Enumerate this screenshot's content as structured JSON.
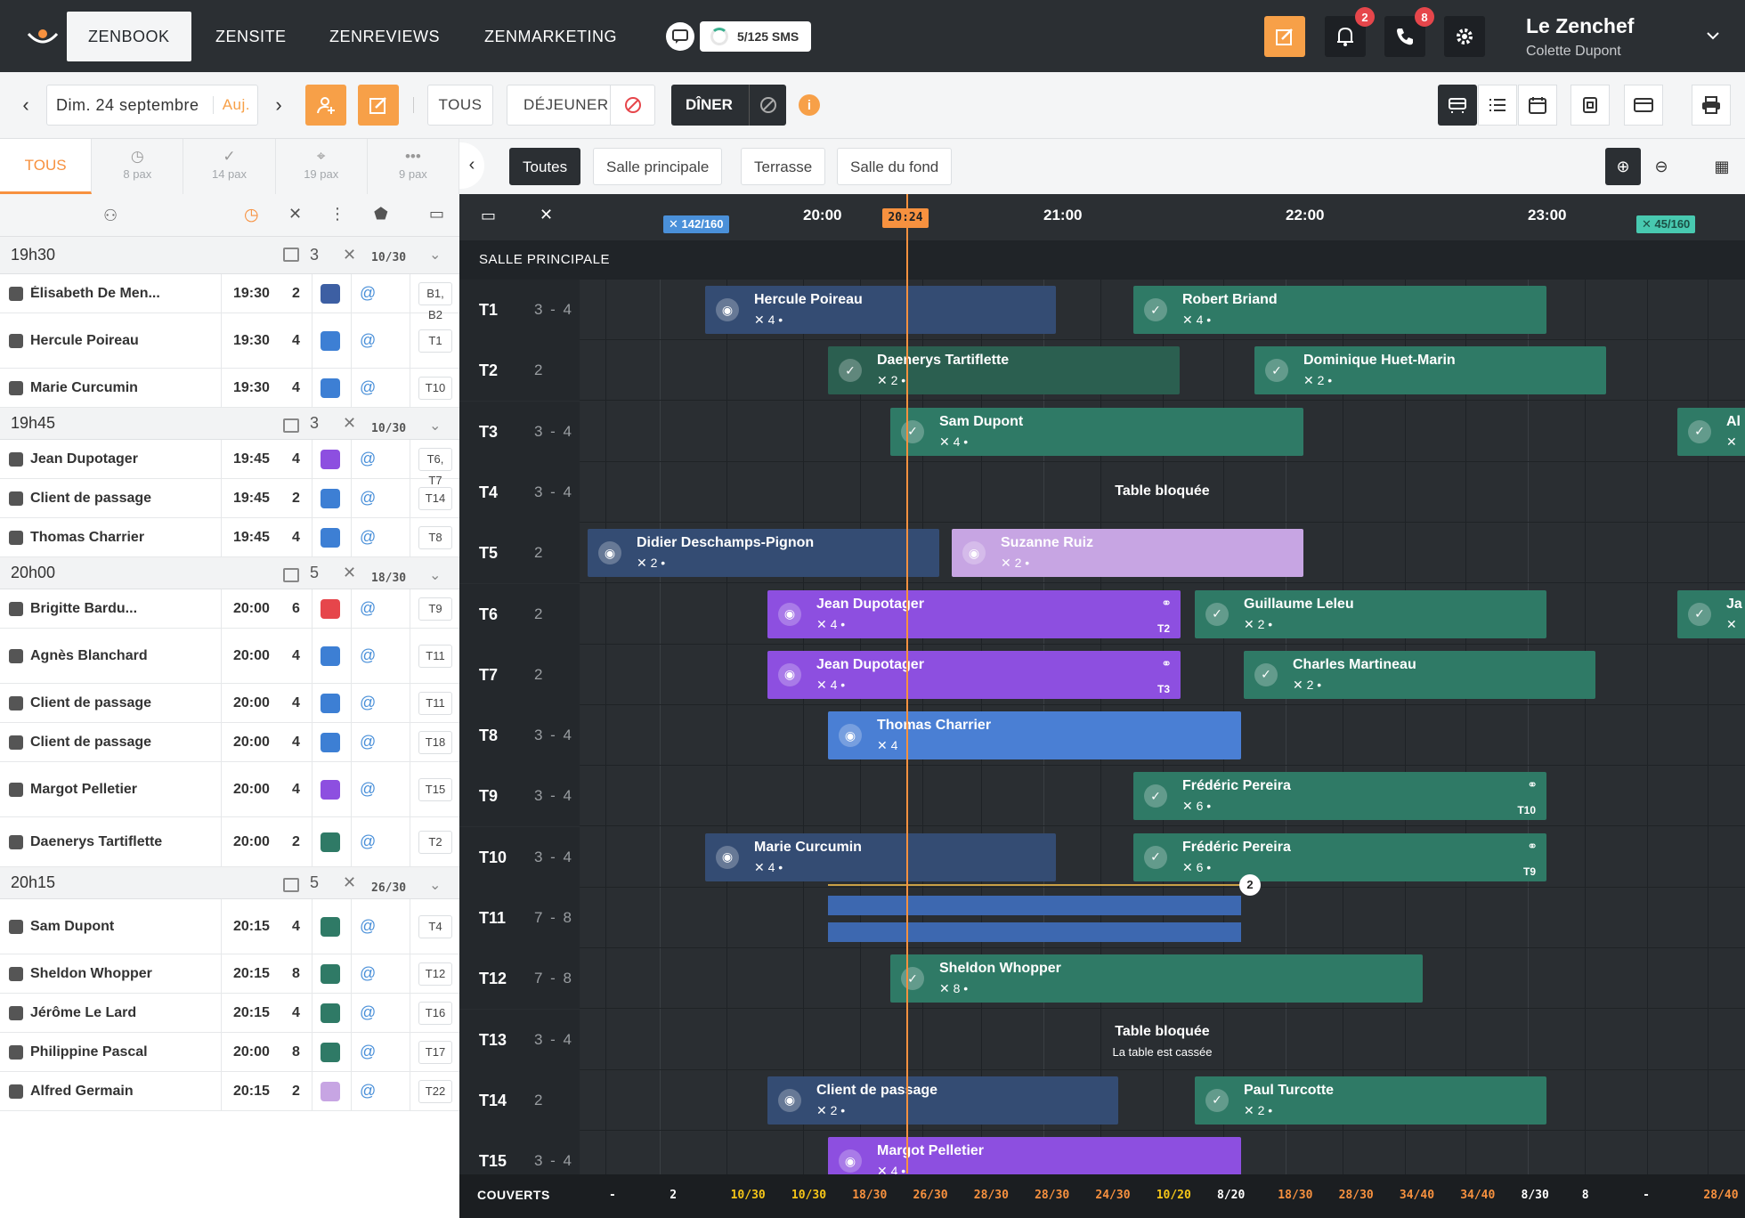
{
  "nav": {
    "tabs": [
      "ZENBOOK",
      "ZENSITE",
      "ZENREVIEWS",
      "ZENMARKETING"
    ],
    "sms": "5/125 SMS",
    "notif_count": "2",
    "calls_count": "8",
    "user_name": "Le Zenchef",
    "user_sub": "Colette Dupont"
  },
  "toolbar": {
    "date": "Dim. 24 septembre",
    "today": "Auj.",
    "all": "TOUS",
    "lunch": "DÉJEUNER",
    "dinner": "DÎNER"
  },
  "side_tabs": [
    {
      "label": "TOUS"
    },
    {
      "label": "8 pax"
    },
    {
      "label": "14 pax"
    },
    {
      "label": "19 pax"
    },
    {
      "label": "9 pax"
    }
  ],
  "rooms": {
    "all": "Toutes",
    "main": "Salle principale",
    "terrace": "Terrasse",
    "back": "Salle du fond"
  },
  "timeline": {
    "hours": [
      "20:00",
      "21:00",
      "22:00",
      "23:00"
    ],
    "now": "20:24",
    "cap_left": "142/160",
    "cap_right": "45/160",
    "section": "SALLE PRINCIPALE",
    "blocked": "Table bloquée",
    "broken": "La table est cassée",
    "couverts_label": "COUVERTS",
    "couverts": [
      "-",
      "2",
      "10/30",
      "10/30",
      "18/30",
      "26/30",
      "28/30",
      "28/30",
      "24/30",
      "10/20",
      "8/20",
      "18/30",
      "28/30",
      "34/40",
      "34/40",
      "8/30",
      "8",
      "-",
      "28/40"
    ]
  },
  "tables": [
    {
      "n": "T1",
      "c": "3 - 4"
    },
    {
      "n": "T2",
      "c": "2"
    },
    {
      "n": "T3",
      "c": "3 - 4"
    },
    {
      "n": "T4",
      "c": "3 - 4"
    },
    {
      "n": "T5",
      "c": "2"
    },
    {
      "n": "T6",
      "c": "2"
    },
    {
      "n": "T7",
      "c": "2"
    },
    {
      "n": "T8",
      "c": "3 - 4"
    },
    {
      "n": "T9",
      "c": "3 - 4"
    },
    {
      "n": "T10",
      "c": "3 - 4"
    },
    {
      "n": "T11",
      "c": "7 - 8"
    },
    {
      "n": "T12",
      "c": "7 - 8"
    },
    {
      "n": "T13",
      "c": "3 - 4"
    },
    {
      "n": "T14",
      "c": "2"
    },
    {
      "n": "T15",
      "c": "3 - 4"
    }
  ],
  "blocks": [
    {
      "name": "Hercule Poireau",
      "sub": "✕ 4 •",
      "cls": "blued"
    },
    {
      "name": "Robert Briand",
      "sub": "✕ 4 •",
      "cls": "green"
    },
    {
      "name": "Daenerys Tartiflette",
      "sub": "✕ 2 •",
      "cls": "greend"
    },
    {
      "name": "Dominique Huet-Marin",
      "sub": "✕ 2 •",
      "cls": "green"
    },
    {
      "name": "Sam Dupont",
      "sub": "✕ 4 •",
      "cls": "green"
    },
    {
      "name": "Didier Deschamps-Pignon",
      "sub": "✕ 2 •",
      "cls": "blued"
    },
    {
      "name": "Suzanne Ruiz",
      "sub": "✕ 2 •",
      "cls": "lilac"
    },
    {
      "name": "Jean Dupotager",
      "sub": "✕ 4 •",
      "cls": "purple",
      "tbl": "T2"
    },
    {
      "name": "Guillaume Leleu",
      "sub": "✕ 2 •",
      "cls": "green"
    },
    {
      "name": "Jean Dupotager",
      "sub": "✕ 4 •",
      "cls": "purple",
      "tbl": "T3"
    },
    {
      "name": "Charles Martineau",
      "sub": "✕ 2 •",
      "cls": "green"
    },
    {
      "name": "Thomas Charrier",
      "sub": "✕ 4",
      "cls": "blue"
    },
    {
      "name": "Frédéric Pereira",
      "sub": "✕ 6 •",
      "cls": "green",
      "tbl": "T10"
    },
    {
      "name": "Marie Curcumin",
      "sub": "✕ 4 •",
      "cls": "blued"
    },
    {
      "name": "Frédéric Pereira",
      "sub": "✕ 6 •",
      "cls": "green",
      "tbl": "T9"
    },
    {
      "name": "Sheldon Whopper",
      "sub": "✕ 8 •",
      "cls": "green"
    },
    {
      "name": "Client de passage",
      "sub": "✕ 2 •",
      "cls": "blued"
    },
    {
      "name": "Paul Turcotte",
      "sub": "✕ 2 •",
      "cls": "green"
    },
    {
      "name": "Margot Pelletier",
      "sub": "✕ 4 •",
      "cls": "purple"
    },
    {
      "name": "Al",
      "sub": "✕",
      "cls": "green"
    },
    {
      "name": "Ja",
      "sub": "✕",
      "cls": "green"
    }
  ],
  "list": [
    {
      "group": "19h30",
      "count": "3",
      "couverts": "10/30"
    },
    {
      "name": "Élisabeth De Men...",
      "time": "19:30",
      "pax": "2",
      "table": "B1, B2",
      "st": "#3d5fa3"
    },
    {
      "name": "Hercule Poireau",
      "time": "19:30",
      "pax": "4",
      "table": "T1",
      "st": "#3d7fd4"
    },
    {
      "name": "Marie Curcumin",
      "time": "19:30",
      "pax": "4",
      "table": "T10",
      "st": "#3d7fd4"
    },
    {
      "group": "19h45",
      "count": "3",
      "couverts": "10/30"
    },
    {
      "name": "Jean Dupotager",
      "time": "19:45",
      "pax": "4",
      "table": "T6, T7",
      "st": "#8d4fe0"
    },
    {
      "name": "Client de passage",
      "time": "19:45",
      "pax": "2",
      "table": "T14",
      "st": "#3d7fd4"
    },
    {
      "name": "Thomas Charrier",
      "time": "19:45",
      "pax": "4",
      "table": "T8",
      "st": "#3d7fd4"
    },
    {
      "group": "20h00",
      "count": "5",
      "couverts": "18/30"
    },
    {
      "name": "Brigitte Bardu...",
      "time": "20:00",
      "pax": "6",
      "table": "T9",
      "st": "#e6464b"
    },
    {
      "name": "Agnès Blanchard",
      "time": "20:00",
      "pax": "4",
      "table": "T11",
      "st": "#3d7fd4"
    },
    {
      "name": "Client de passage",
      "time": "20:00",
      "pax": "4",
      "table": "T11",
      "st": "#3d7fd4"
    },
    {
      "name": "Client de passage",
      "time": "20:00",
      "pax": "4",
      "table": "T18",
      "st": "#3d7fd4"
    },
    {
      "name": "Margot Pelletier",
      "time": "20:00",
      "pax": "4",
      "table": "T15",
      "st": "#8d4fe0"
    },
    {
      "name": "Daenerys Tartiflette",
      "time": "20:00",
      "pax": "2",
      "table": "T2",
      "st": "#2f7a66"
    },
    {
      "group": "20h15",
      "count": "5",
      "couverts": "26/30"
    },
    {
      "name": "Sam Dupont",
      "time": "20:15",
      "pax": "4",
      "table": "T4",
      "st": "#2f7a66"
    },
    {
      "name": "Sheldon Whopper",
      "time": "20:15",
      "pax": "8",
      "table": "T12",
      "st": "#2f7a66"
    },
    {
      "name": "Jérôme Le Lard",
      "time": "20:15",
      "pax": "4",
      "table": "T16",
      "st": "#2f7a66"
    },
    {
      "name": "Philippine Pascal",
      "time": "20:00",
      "pax": "8",
      "table": "T17",
      "st": "#2f7a66"
    },
    {
      "name": "Alfred Germain",
      "time": "20:15",
      "pax": "2",
      "table": "T22",
      "st": "#c7a5e3"
    }
  ]
}
